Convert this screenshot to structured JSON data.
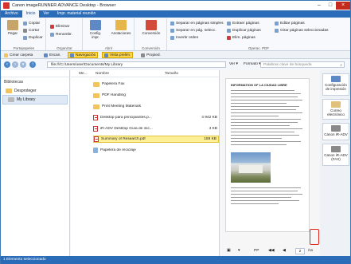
{
  "window": {
    "title": "Canon imageRUNNER ADVANCE Desktop - Browser"
  },
  "menu": [
    "Archivo",
    "Inicio",
    "Ver",
    "Impr. material reunión"
  ],
  "ribbon": {
    "portapapeles": {
      "label": "Portapapeles",
      "pegar": "Pegar",
      "copiar": "Copiar",
      "cortar": "Cortar",
      "duplicar": "Duplicar"
    },
    "organizar": {
      "label": "Organizar",
      "eliminar": "Eliminar",
      "renombrar": "Renombr."
    },
    "abrir": {
      "label": "Abrir",
      "config": "Config.",
      "config2": "impr.",
      "anotaciones": "Anotaciones"
    },
    "conversion": {
      "label": "Conversión",
      "btn": "Conversión"
    },
    "operac": {
      "label": "Operac. PDF",
      "items": [
        "Separar en páginas simples",
        "Separar en pág. selecc.",
        "Invertir orden",
        "Extraer páginas",
        "Duplicar páginas",
        "Elim. páginas",
        "Editar páginas",
        "Girar páginas seleccionadas"
      ]
    }
  },
  "toolbar2": {
    "crear": "Crear carpeta",
    "escan": "Escan.",
    "navegacion": "Navegación",
    "vista": "Vista prelim.",
    "propied": "Propied."
  },
  "address": {
    "path": "file:///C:/Users/user/Documents/My Library",
    "ver": "Ver",
    "formato": "Formato",
    "search_placeholder": "Palabras clave de búsqueda"
  },
  "left": {
    "header": "Bibliotecas",
    "items": [
      "Desproteger",
      "My Library"
    ]
  },
  "files": {
    "columns": [
      "Me...",
      "Nombre",
      "Tamaño"
    ],
    "rows": [
      {
        "name": "Papelera Fax",
        "size": ""
      },
      {
        "name": "PDF Handling",
        "size": ""
      },
      {
        "name": "Print Meeting Materials",
        "size": ""
      },
      {
        "name": "Desktop para principiantes.p...",
        "size": "4 942 KB"
      },
      {
        "name": "iR-ADV Desktop Guía de inic...",
        "size": "4 KB"
      },
      {
        "name": "Summary of Research.pdf",
        "size": "159 KB"
      },
      {
        "name": "Papelera de reciclaje",
        "size": ""
      }
    ]
  },
  "preview": {
    "doc_title": "INFORMATION OF LA CIUDAD LIBRE",
    "page": "2",
    "total": "/11",
    "pp": "PP"
  },
  "right": {
    "tiles": [
      "Configuración de impresión",
      "Correo electrónico",
      "Canon iR-ADV",
      "Canon iR-ADV (FAX)"
    ]
  },
  "status": "1 Elemento seleccionado"
}
